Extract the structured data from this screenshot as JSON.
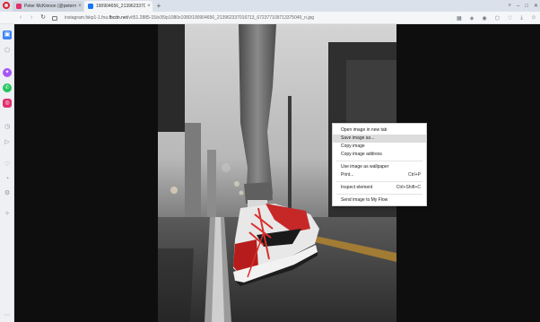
{
  "tabs": [
    {
      "title": "Peter McKinnon (@petermck",
      "favicon_color": "#e1306c",
      "active": false
    },
    {
      "title": "190904656_2139623370167",
      "favicon_color": "#1877f2",
      "active": true
    }
  ],
  "address_bar": {
    "url_prefix": "instagram.fskp1-1.fna.",
    "url_host": "fbcdn.net",
    "url_suffix": "/v/t51.2885-15/e35/p1080x1080/190904656_213962337016713_672377109713375040_n.jpg"
  },
  "context_menu": {
    "items": [
      {
        "label": "Open image in new tab",
        "shortcut": ""
      },
      {
        "label": "Save image as...",
        "shortcut": "",
        "highlighted": true
      },
      {
        "label": "Copy image",
        "shortcut": ""
      },
      {
        "label": "Copy image address",
        "shortcut": ""
      },
      {
        "label": "Use image as wallpaper",
        "shortcut": ""
      },
      {
        "label": "Print...",
        "shortcut": "Ctrl+P"
      },
      {
        "label": "Inspect element",
        "shortcut": "Ctrl+Shift+C"
      },
      {
        "label": "Send image to My Flow",
        "shortcut": ""
      }
    ]
  },
  "icons": {
    "sidebar": [
      "speed-dial-icon",
      "extensions-icon",
      "messenger-icon",
      "whatsapp-icon",
      "instagram-icon",
      "snapshot-icon",
      "send-icon",
      "heart-icon",
      "history-icon",
      "settings-icon",
      "my-flow-icon",
      "more-icon"
    ],
    "toolbar": [
      "back-icon",
      "forward-icon",
      "reload-icon",
      "grid-icon",
      "vpn-icon",
      "camera-icon",
      "extensions-icon",
      "heart-icon",
      "download-icon",
      "profile-icon"
    ]
  },
  "colors": {
    "opera_red": "#e0202a",
    "accent_blue": "#3b82f6",
    "menu_highlight": "#dcdcdc",
    "viewer_background": "#0e0e0e"
  }
}
